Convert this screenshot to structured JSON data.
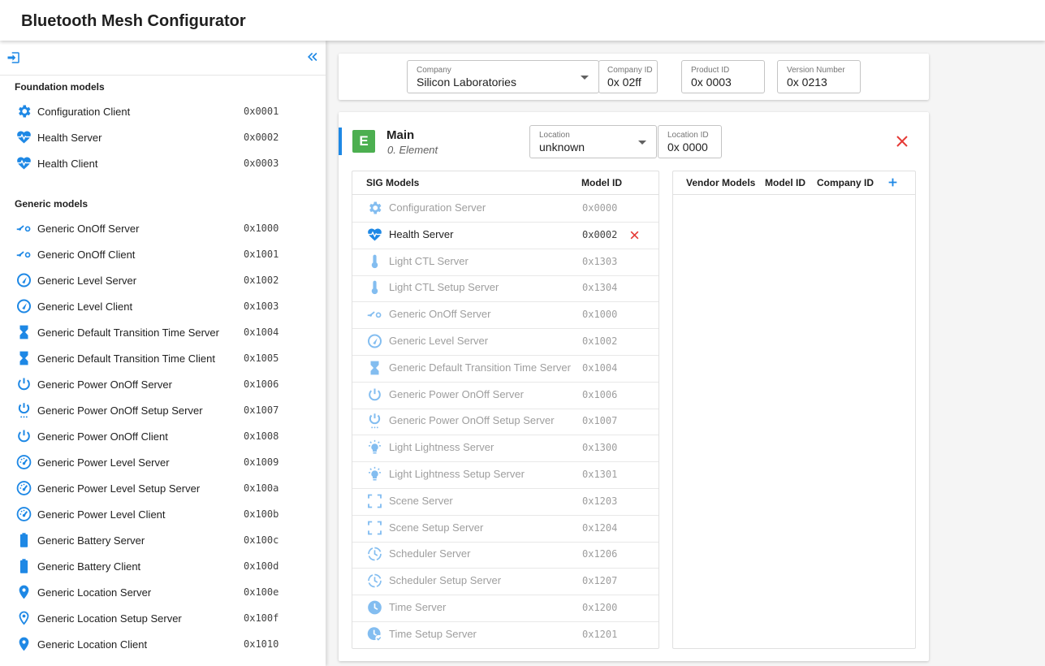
{
  "app": {
    "title": "Bluetooth Mesh Configurator"
  },
  "colors": {
    "accent": "#1e88e5",
    "icon_blue": "#1e88e5",
    "element_green": "#4caf50",
    "delete_red": "#e53935"
  },
  "sidebar": {
    "sections": [
      {
        "title": "Foundation models",
        "items": [
          {
            "name": "Configuration Client",
            "id": "0x0001",
            "icon": "gear-icon"
          },
          {
            "name": "Health Server",
            "id": "0x0002",
            "icon": "heartbeat-icon"
          },
          {
            "name": "Health Client",
            "id": "0x0003",
            "icon": "heartbeat-icon"
          }
        ]
      },
      {
        "title": "Generic models",
        "items": [
          {
            "name": "Generic OnOff Server",
            "id": "0x1000",
            "icon": "switch-icon"
          },
          {
            "name": "Generic OnOff Client",
            "id": "0x1001",
            "icon": "switch-icon"
          },
          {
            "name": "Generic Level Server",
            "id": "0x1002",
            "icon": "gauge-icon"
          },
          {
            "name": "Generic Level Client",
            "id": "0x1003",
            "icon": "gauge-icon"
          },
          {
            "name": "Generic Default Transition Time Server",
            "id": "0x1004",
            "icon": "hourglass-icon"
          },
          {
            "name": "Generic Default Transition Time Client",
            "id": "0x1005",
            "icon": "hourglass-icon"
          },
          {
            "name": "Generic Power OnOff Server",
            "id": "0x1006",
            "icon": "power-icon"
          },
          {
            "name": "Generic Power OnOff Setup Server",
            "id": "0x1007",
            "icon": "power-settings-icon"
          },
          {
            "name": "Generic Power OnOff Client",
            "id": "0x1008",
            "icon": "power-icon"
          },
          {
            "name": "Generic Power Level Server",
            "id": "0x1009",
            "icon": "speedometer-icon"
          },
          {
            "name": "Generic Power Level Setup Server",
            "id": "0x100a",
            "icon": "speedometer-icon"
          },
          {
            "name": "Generic Power Level Client",
            "id": "0x100b",
            "icon": "speedometer-icon"
          },
          {
            "name": "Generic Battery Server",
            "id": "0x100c",
            "icon": "battery-icon"
          },
          {
            "name": "Generic Battery Client",
            "id": "0x100d",
            "icon": "battery-icon"
          },
          {
            "name": "Generic Location Server",
            "id": "0x100e",
            "icon": "location-pin-icon"
          },
          {
            "name": "Generic Location Setup Server",
            "id": "0x100f",
            "icon": "location-pin-outline-icon"
          },
          {
            "name": "Generic Location Client",
            "id": "0x1010",
            "icon": "location-pin-icon"
          }
        ]
      }
    ]
  },
  "company_bar": {
    "company": {
      "label": "Company",
      "value": "Silicon Laboratories"
    },
    "company_id": {
      "label": "Company ID",
      "value": "0x 02ff"
    },
    "product_id": {
      "label": "Product ID",
      "value": "0x 0003"
    },
    "version_number": {
      "label": "Version Number",
      "value": "0x 0213"
    }
  },
  "element": {
    "badge": "E",
    "name": "Main",
    "subtitle": "0. Element",
    "location": {
      "label": "Location",
      "value": "unknown"
    },
    "location_id": {
      "label": "Location ID",
      "value": "0x 0000"
    }
  },
  "sig_table": {
    "headers": {
      "models": "SIG Models",
      "model_id": "Model ID"
    },
    "rows": [
      {
        "name": "Configuration Server",
        "id": "0x0000",
        "icon": "gear-icon",
        "active": false
      },
      {
        "name": "Health Server",
        "id": "0x0002",
        "icon": "heartbeat-icon",
        "active": true
      },
      {
        "name": "Light CTL Server",
        "id": "0x1303",
        "icon": "thermometer-icon",
        "active": false
      },
      {
        "name": "Light CTL Setup Server",
        "id": "0x1304",
        "icon": "thermometer-icon",
        "active": false
      },
      {
        "name": "Generic OnOff Server",
        "id": "0x1000",
        "icon": "switch-icon",
        "active": false
      },
      {
        "name": "Generic Level Server",
        "id": "0x1002",
        "icon": "gauge-icon",
        "active": false
      },
      {
        "name": "Generic Default Transition Time Server",
        "id": "0x1004",
        "icon": "hourglass-icon",
        "active": false
      },
      {
        "name": "Generic Power OnOff Server",
        "id": "0x1006",
        "icon": "power-icon",
        "active": false
      },
      {
        "name": "Generic Power OnOff Setup Server",
        "id": "0x1007",
        "icon": "power-settings-icon",
        "active": false
      },
      {
        "name": "Light Lightness Server",
        "id": "0x1300",
        "icon": "lightbulb-icon",
        "active": false
      },
      {
        "name": "Light Lightness Setup Server",
        "id": "0x1301",
        "icon": "lightbulb-icon",
        "active": false
      },
      {
        "name": "Scene Server",
        "id": "0x1203",
        "icon": "scene-frame-icon",
        "active": false
      },
      {
        "name": "Scene Setup Server",
        "id": "0x1204",
        "icon": "scene-frame-icon",
        "active": false
      },
      {
        "name": "Scheduler Server",
        "id": "0x1206",
        "icon": "clock-outline-icon",
        "active": false
      },
      {
        "name": "Scheduler Setup Server",
        "id": "0x1207",
        "icon": "clock-outline-icon",
        "active": false
      },
      {
        "name": "Time Server",
        "id": "0x1200",
        "icon": "clock-icon",
        "active": false
      },
      {
        "name": "Time Setup Server",
        "id": "0x1201",
        "icon": "clock-check-icon",
        "active": false
      }
    ]
  },
  "vendor_table": {
    "headers": {
      "models": "Vendor Models",
      "model_id": "Model ID",
      "company_id": "Company ID"
    }
  }
}
